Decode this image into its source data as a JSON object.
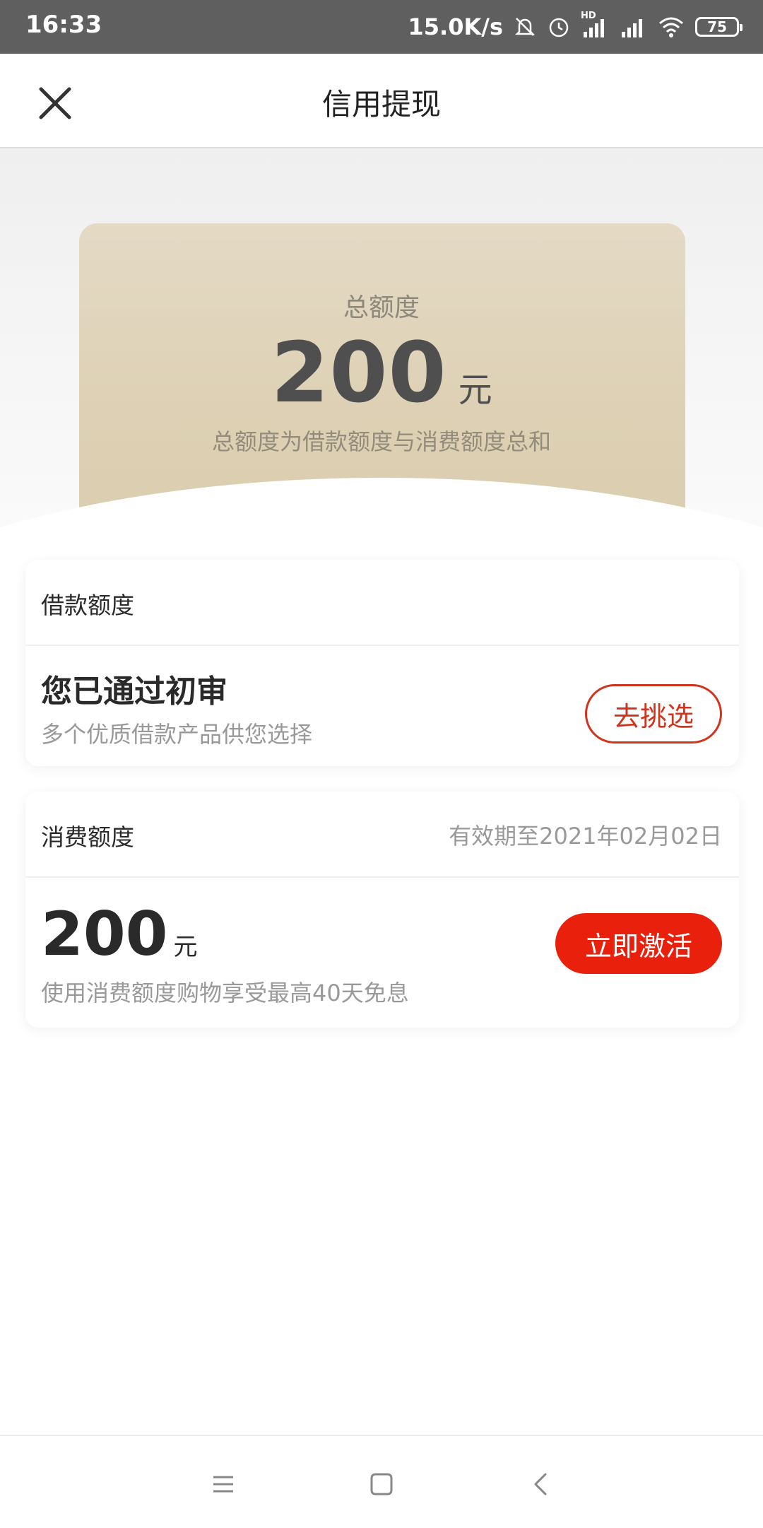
{
  "status_bar": {
    "time": "16:33",
    "net_speed": "15.0K/s",
    "network_badge": "HD",
    "battery": "75",
    "icons": [
      "mute-icon",
      "alarm-icon",
      "hd-signal-icon",
      "signal-icon",
      "wifi-icon",
      "battery-icon"
    ]
  },
  "header": {
    "title": "信用提现",
    "close_icon": "close-icon"
  },
  "hero": {
    "label": "总额度",
    "amount": "200",
    "unit": "元",
    "note": "总额度为借款额度与消费额度总和"
  },
  "loan": {
    "title": "借款额度",
    "main": "您已通过初审",
    "sub": "多个优质借款产品供您选择",
    "button": "去挑选"
  },
  "consume": {
    "title": "消费额度",
    "validity": "有效期至2021年02月02日",
    "amount": "200",
    "unit": "元",
    "sub": "使用消费额度购物享受最高40天免息",
    "button": "立即激活"
  },
  "nav": {
    "icons": [
      "menu-icon",
      "home-icon",
      "back-icon"
    ]
  },
  "colors": {
    "accent": "#e8200c",
    "outline": "#d0341d",
    "card_gold": "#ddd0b4"
  }
}
